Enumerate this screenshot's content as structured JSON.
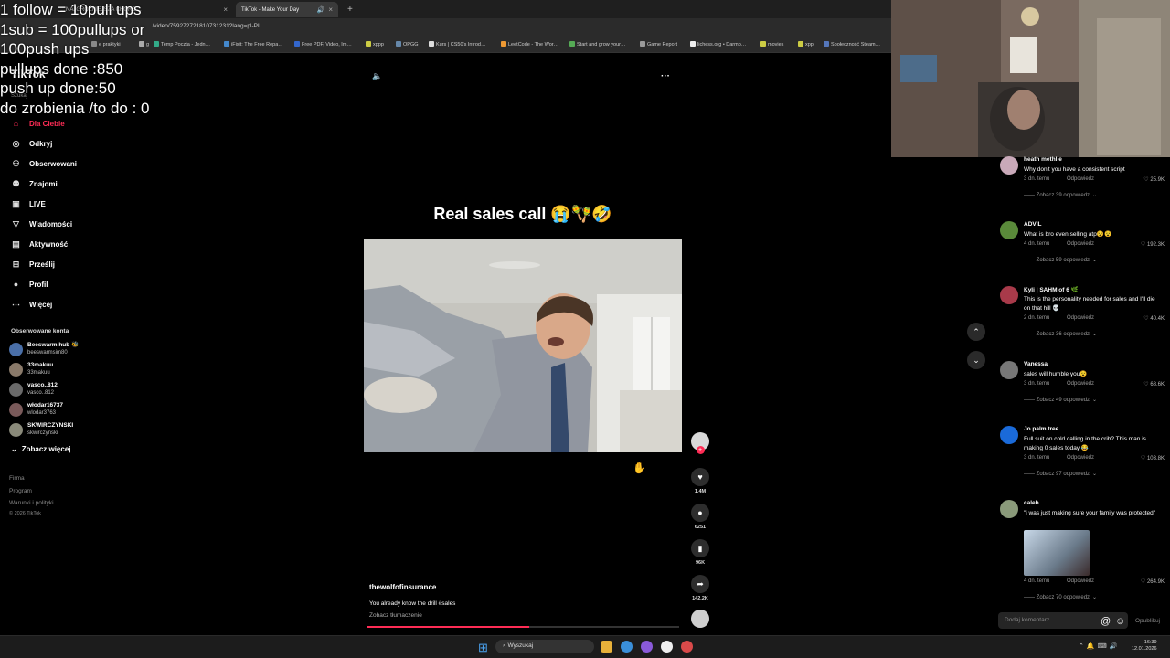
{
  "browser": {
    "tabs": [
      {
        "label": "…NAJGROŹNIEJSZA CHORO…",
        "active": false
      },
      {
        "label": "TikTok - Make Your Day",
        "active": true
      }
    ],
    "new_tab": "+",
    "close": "×",
    "url": "…/video/759272721810731231?lang=pl-PL",
    "bookmarks": [
      "e praktyki",
      "g",
      "Temp Poczta - Jedn…",
      "iFixit: The Free Repa…",
      "Free PDF, Video, Im…",
      "xppp",
      "OPGG",
      "Kurs | CS50's Introd…",
      "LeetCode - The Wor…",
      "Start and grow your…",
      "Game Report",
      "lichess.org • Darmo…",
      "movies",
      "xpp",
      "Społeczność Steam…"
    ]
  },
  "overlay_lines": [
    "1 follow = 10pull ups",
    "1sub = 100pullups or",
    "100push ups",
    "pullups done :850",
    "push up done:50",
    "do zrobienia /to do : 0"
  ],
  "sidebar": {
    "logo": "TikTok",
    "search_placeholder": "Szukaj",
    "nav": [
      {
        "label": "Dla Ciebie",
        "icon": "home-icon",
        "glyph": "⌂",
        "selected": true
      },
      {
        "label": "Odkryj",
        "icon": "compass-icon",
        "glyph": "◎"
      },
      {
        "label": "Obserwowani",
        "icon": "following-icon",
        "glyph": "⚇"
      },
      {
        "label": "Znajomi",
        "icon": "friends-icon",
        "glyph": "⚉"
      },
      {
        "label": "LIVE",
        "icon": "live-icon",
        "glyph": "▣"
      },
      {
        "label": "Wiadomości",
        "icon": "messages-icon",
        "glyph": "▽"
      },
      {
        "label": "Aktywność",
        "icon": "activity-icon",
        "glyph": "▤"
      },
      {
        "label": "Prześlij",
        "icon": "upload-icon",
        "glyph": "⊞"
      },
      {
        "label": "Profil",
        "icon": "profile-icon",
        "glyph": "●"
      },
      {
        "label": "Więcej",
        "icon": "more-icon",
        "glyph": "⋯"
      }
    ],
    "following_title": "Obserwowane konta",
    "following": [
      {
        "name": "Beeswarm hub 🐝",
        "user": "beeswarmsim80"
      },
      {
        "name": "33makuu",
        "user": "33makuu"
      },
      {
        "name": "vasco..812",
        "user": "vasco..812"
      },
      {
        "name": "włodar16737",
        "user": "wlodar3763"
      },
      {
        "name": "SKWIRCZYNSKI",
        "user": "skwirczynski"
      }
    ],
    "see_more": "Zobacz więcej",
    "footer": [
      "Firma",
      "Program",
      "Warunki i polityki",
      "© 2026 TikTok"
    ]
  },
  "video": {
    "title": "Real sales call 😭🪇🤣",
    "username": "thewolfofinsurance",
    "caption": "You already know the drill #sales",
    "translate": "Zobacz tłumaczenie",
    "progress": 0.52,
    "sound_icon": "🔈",
    "menu_icon": "···",
    "actions": [
      {
        "name": "like-icon",
        "glyph": "♥",
        "count": "1.4M"
      },
      {
        "name": "comment-icon",
        "glyph": "●",
        "count": "6251"
      },
      {
        "name": "bookmark-icon",
        "glyph": "▮",
        "count": "96K"
      },
      {
        "name": "share-icon",
        "glyph": "➦",
        "count": "142.2K"
      }
    ]
  },
  "comments": [
    {
      "user": "heath methlie",
      "text": "Why don't you have a consistent script",
      "time": "3 dn. temu",
      "reply": "Odpowiedz",
      "likes": "25.9K",
      "more": "Zobacz 39 odpowiedzi ⌄"
    },
    {
      "user": "ADVIL",
      "text": "What is bro even selling atp😵😵",
      "time": "4 dn. temu",
      "reply": "Odpowiedz",
      "likes": "192.3K",
      "more": "Zobacz 59 odpowiedzi ⌄"
    },
    {
      "user": "Kyli | SAHM of 6 🌿",
      "text": "This is the personality needed for sales and I'll die on that hill 💀",
      "time": "2 dn. temu",
      "reply": "Odpowiedz",
      "likes": "40.4K",
      "more": "Zobacz 36 odpowiedzi ⌄"
    },
    {
      "user": "Vanessa",
      "text": "sales will humble you😵",
      "time": "3 dn. temu",
      "reply": "Odpowiedz",
      "likes": "68.6K",
      "more": "Zobacz 49 odpowiedzi ⌄"
    },
    {
      "user": "Jo palm tree",
      "text": "Full suit on cold calling in the crib? This man is making 0 sales today 😂",
      "time": "3 dn. temu",
      "reply": "Odpowiedz",
      "likes": "103.8K",
      "more": "Zobacz 97 odpowiedzi ⌄"
    },
    {
      "user": "caleb",
      "text": "\"i was just making sure your family was protected\"",
      "time": "4 dn. temu",
      "reply": "Odpowiedz",
      "likes": "264.9K",
      "more": "Zobacz 70 odpowiedzi ⌄"
    }
  ],
  "comment_box": {
    "placeholder": "Dodaj komentarz...",
    "at": "@",
    "emoji": "☺",
    "publish": "Opublikuj"
  },
  "taskbar": {
    "search": "Wyszukaj",
    "time": "16:39",
    "date": "12.01.2026"
  }
}
